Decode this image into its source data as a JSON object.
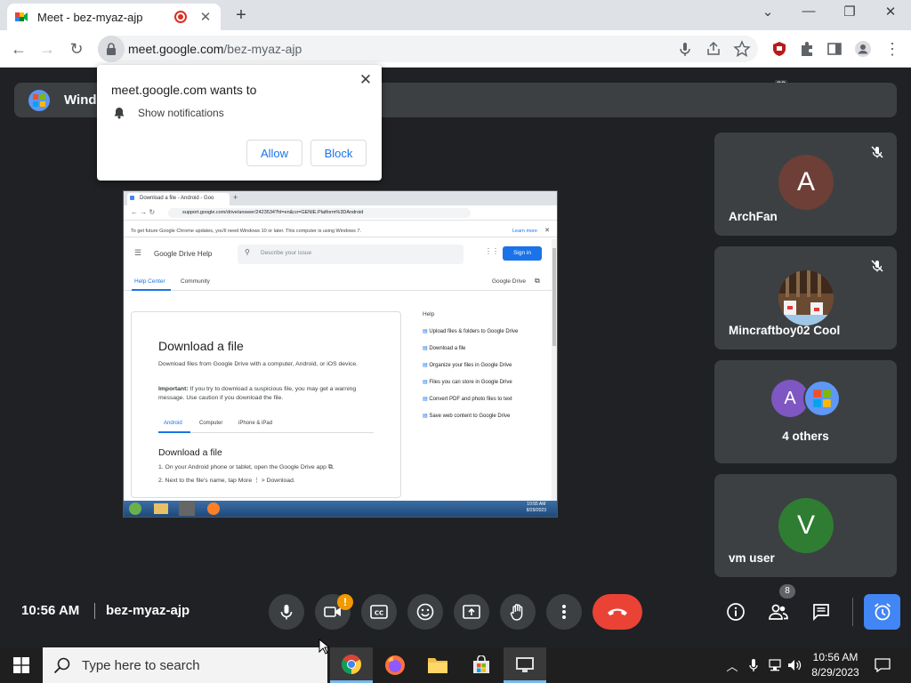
{
  "browser": {
    "tab_title": "Meet - bez-myaz-ajp",
    "url_host": "meet.google.com",
    "url_path": "/bez-myaz-ajp",
    "extension_badge": "33"
  },
  "banner": {
    "name": "Windo"
  },
  "notification_prompt": {
    "title": "meet.google.com wants to",
    "permission": "Show notifications",
    "allow_label": "Allow",
    "block_label": "Block"
  },
  "shared_screen": {
    "tab_title": "Download a file - Android - Goo",
    "url": "support.google.com/drive/answer/2423534?hl=en&co=GENIE.Platform%3DAndroid",
    "warning": "To get future Google Chrome updates, you'll need Windows 10 or later. This computer is using Windows 7.",
    "learn_more": "Learn more",
    "product": "Google Drive Help",
    "search_placeholder": "Describe your issue",
    "sign_in": "Sign in",
    "tabs": [
      "Help Center",
      "Community"
    ],
    "drive_link": "Google Drive",
    "heading": "Download a file",
    "intro": "Download files from Google Drive with a computer, Android, or iOS device.",
    "important_label": "Important:",
    "important_text": "If you try to download a suspicious file, you may get a warning message. Use caution if you download the file.",
    "platform_tabs": [
      "Android",
      "Computer",
      "iPhone & iPad"
    ],
    "sub_heading": "Download a file",
    "steps": [
      "1. On your Android phone or tablet, open the Google Drive app ⧉.",
      "2. Next to the file's name, tap More ⋮ > Download."
    ],
    "help_title": "Help",
    "help_links": [
      "Upload files & folders to Google Drive",
      "Download a file",
      "Organize your files in Google Drive",
      "Files you can store in Google Drive",
      "Convert PDF and photo files to text",
      "Save web content to Google Drive"
    ],
    "clock_time": "10:55 AM",
    "clock_date": "8/29/2023"
  },
  "participants": [
    {
      "name": "ArchFan",
      "initial": "A",
      "color": "#6d3f36"
    },
    {
      "name": "Mincraftboy02 Cool"
    },
    {
      "name": "4 others",
      "initial": "A"
    },
    {
      "name": "vm user",
      "initial": "V",
      "color": "#2e7d32"
    }
  ],
  "meeting": {
    "time": "10:56 AM",
    "code": "bez-myaz-ajp",
    "camera_alert": "!",
    "people_count": "8"
  },
  "taskbar": {
    "search_placeholder": "Type here to search",
    "time": "10:56 AM",
    "date": "8/29/2023"
  },
  "colors": {
    "meet_bg": "#202124",
    "tile_bg": "#3c4043",
    "end_call": "#ea4335",
    "accent_blue": "#1a73e8"
  }
}
